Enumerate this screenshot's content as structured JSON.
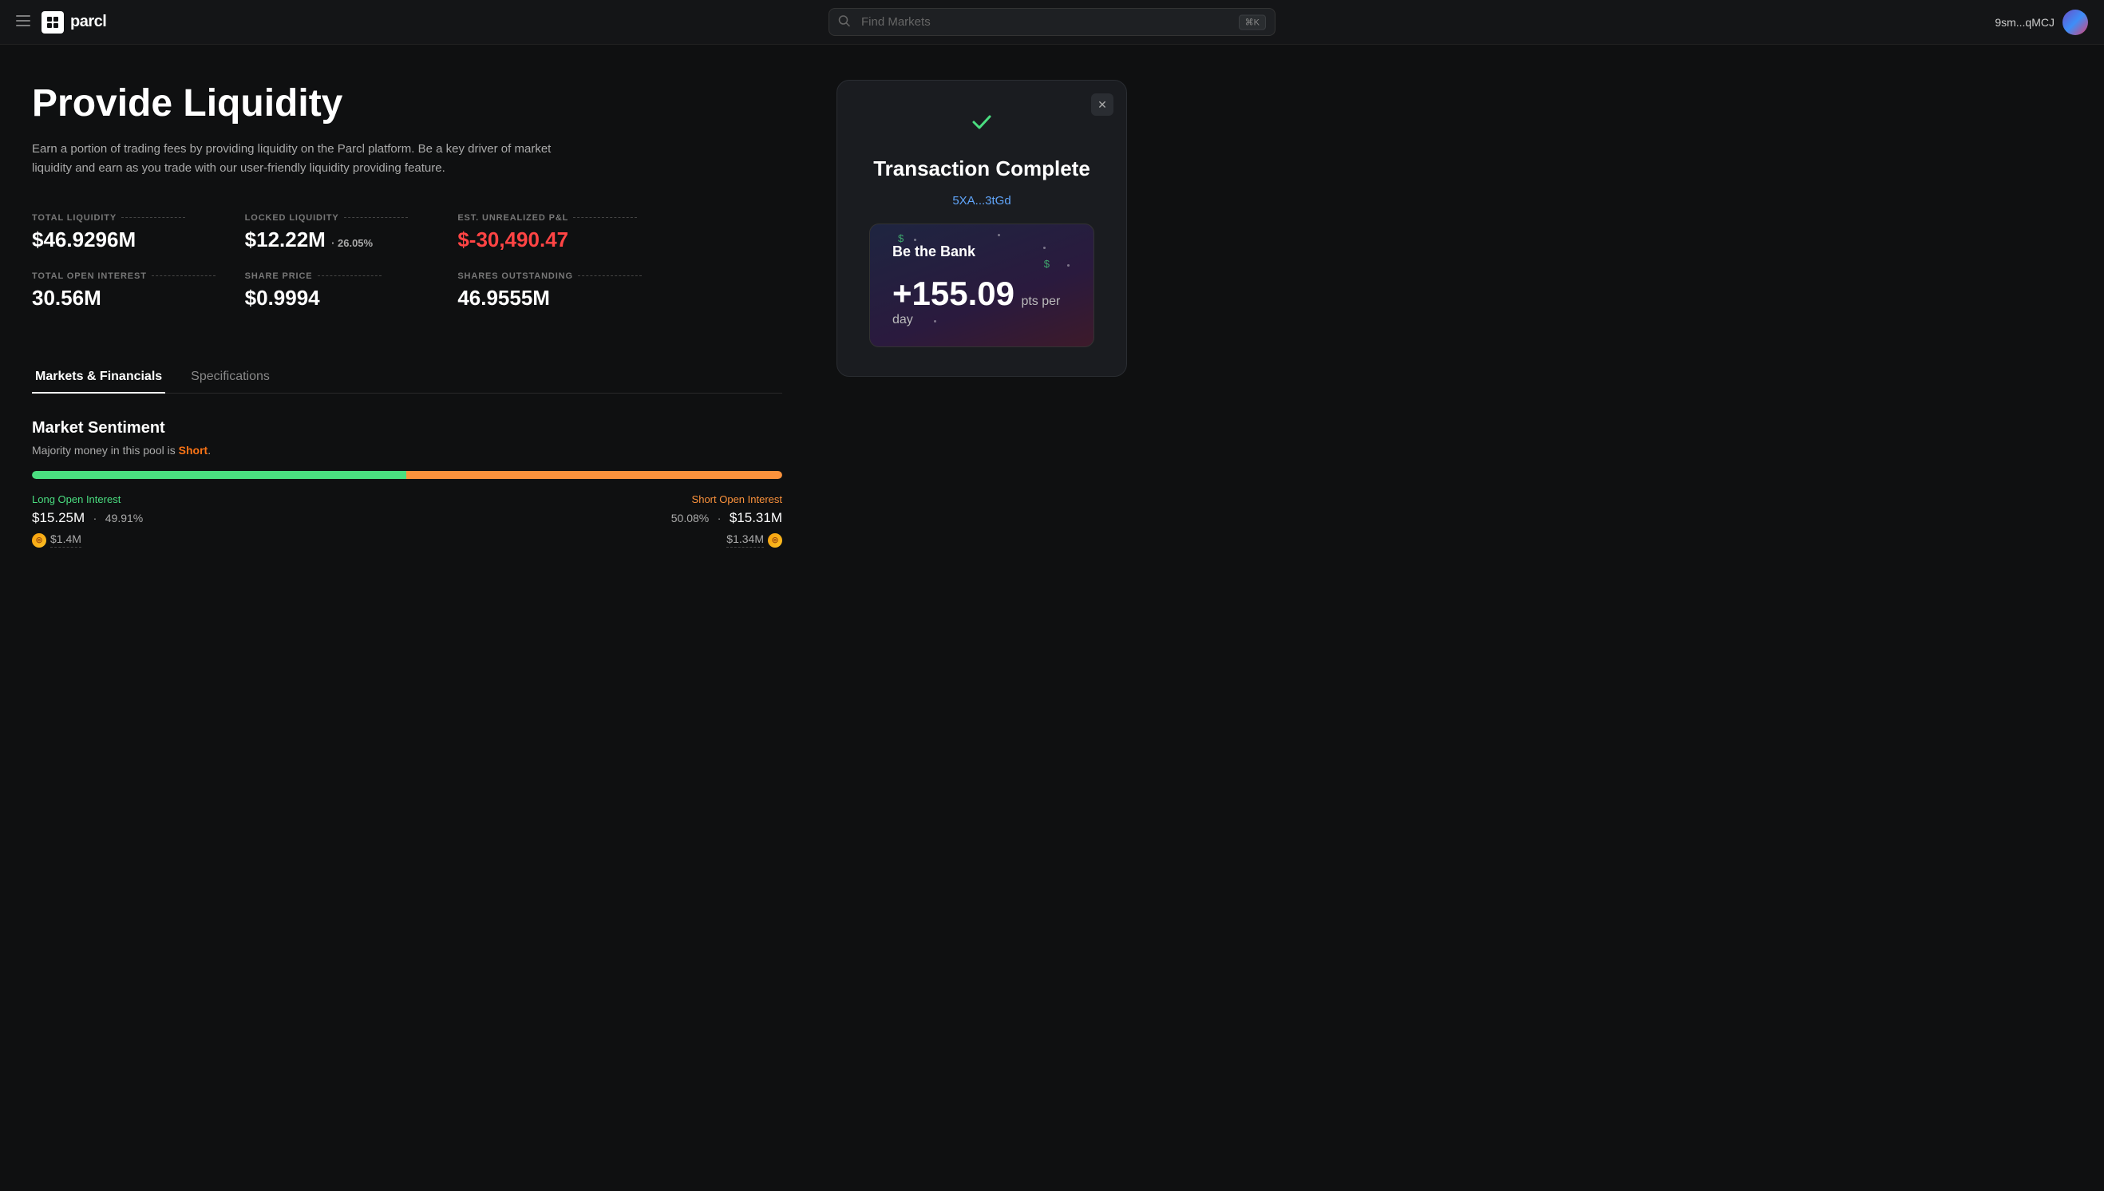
{
  "header": {
    "menu_label": "☰",
    "logo_text": "parcl",
    "search_placeholder": "Find Markets",
    "search_shortcut": "⌘K",
    "wallet": "9sm...qMCJ"
  },
  "page": {
    "title": "Provide Liquidity",
    "description": "Earn a portion of trading fees by providing liquidity on the Parcl platform. Be a key driver of market liquidity and earn as you trade with our user-friendly liquidity providing feature."
  },
  "stats": [
    {
      "label": "TOTAL LIQUIDITY",
      "value": "$46.9296M"
    },
    {
      "label": "LOCKED LIQUIDITY",
      "value": "$12.22M",
      "sub": "26.05%"
    },
    {
      "label": "EST. UNREALIZED P&L",
      "value": "$-30,490.47",
      "negative": true
    },
    {
      "label": "TOTAL OPEN INTEREST",
      "value": "30.56M"
    },
    {
      "label": "SHARE PRICE",
      "value": "$0.9994"
    },
    {
      "label": "SHARES OUTSTANDING",
      "value": "46.9555M"
    }
  ],
  "tabs": [
    {
      "label": "Markets & Financials",
      "active": true
    },
    {
      "label": "Specifications",
      "active": false
    }
  ],
  "market_sentiment": {
    "section_title": "Market Sentiment",
    "description_prefix": "Majority money in this pool is ",
    "sentiment_word": "Short",
    "long_label": "Long Open Interest",
    "short_label": "Short Open Interest",
    "long_value": "$15.25M",
    "long_pct": "49.91%",
    "short_value": "$15.31M",
    "short_pct": "50.08%",
    "long_sub": "$1.4M",
    "short_sub": "$1.34M",
    "long_bar_pct": 49.91,
    "short_bar_pct": 50.09
  },
  "transaction": {
    "check": "✓",
    "title": "Transaction Complete",
    "hash": "5XA...3tGd",
    "close": "✕"
  },
  "bank_card": {
    "label": "Be the Bank",
    "pts_prefix": "+155.09",
    "pts_unit": "pts per day"
  }
}
